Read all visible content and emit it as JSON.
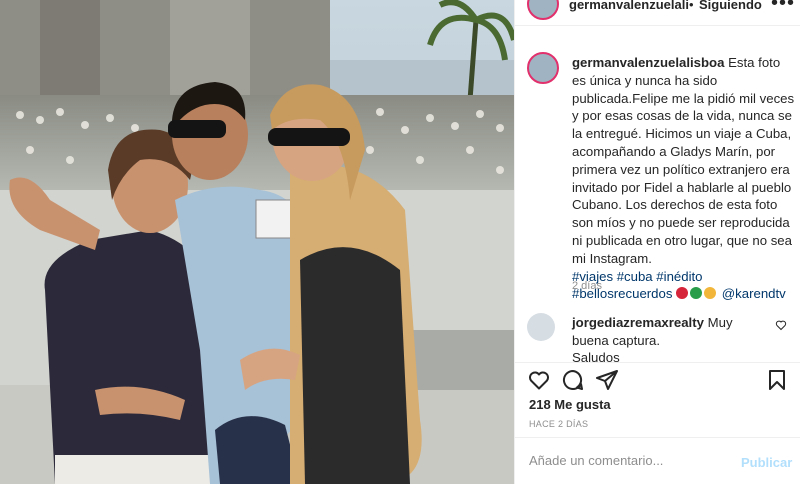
{
  "post": {
    "username": "germanvalenzuelalisboa",
    "username_truncated": "germanvalenzuelalisbc",
    "separator": "•",
    "follow_state": "Siguiendo",
    "more": "•••"
  },
  "caption": {
    "username": "germanvalenzuelalisboa",
    "text": "Esta foto es única y nunca ha sido publicada.Felipe me la pidió mil veces y por esas cosas de la vida, nunca se la entregué. Hicimos un viaje a Cuba, acompañando a Gladys Marín, por primera vez un político extranjero era invitado por Fidel a hablarle al pueblo Cubano. Los derechos de esta foto son míos y no puede ser reproducida ni publicada en otro lugar, que no sea mi Instagram.",
    "hashtags_line1": "#viajes #cuba #inédito",
    "hashtags_line2": "#bellosrecuerdos",
    "mention": "@karendtv",
    "time": "2 días"
  },
  "comment": {
    "username": "jorgediazremaxrealty",
    "text": "Muy buena captura.",
    "text_line2": "Saludos"
  },
  "likes": "218 Me gusta",
  "date": "HACE 2 DÍAS",
  "add_comment": {
    "placeholder": "Añade un comentario...",
    "publish": "Publicar"
  },
  "icons": [
    "heart-icon",
    "comment-icon",
    "share-icon",
    "bookmark-icon",
    "more-icon",
    "like-comment-icon"
  ],
  "colors": {
    "link": "#00376b",
    "muted": "#8e8e8e",
    "publish_disabled": "#b2dffc",
    "ring": "#e1306c"
  }
}
